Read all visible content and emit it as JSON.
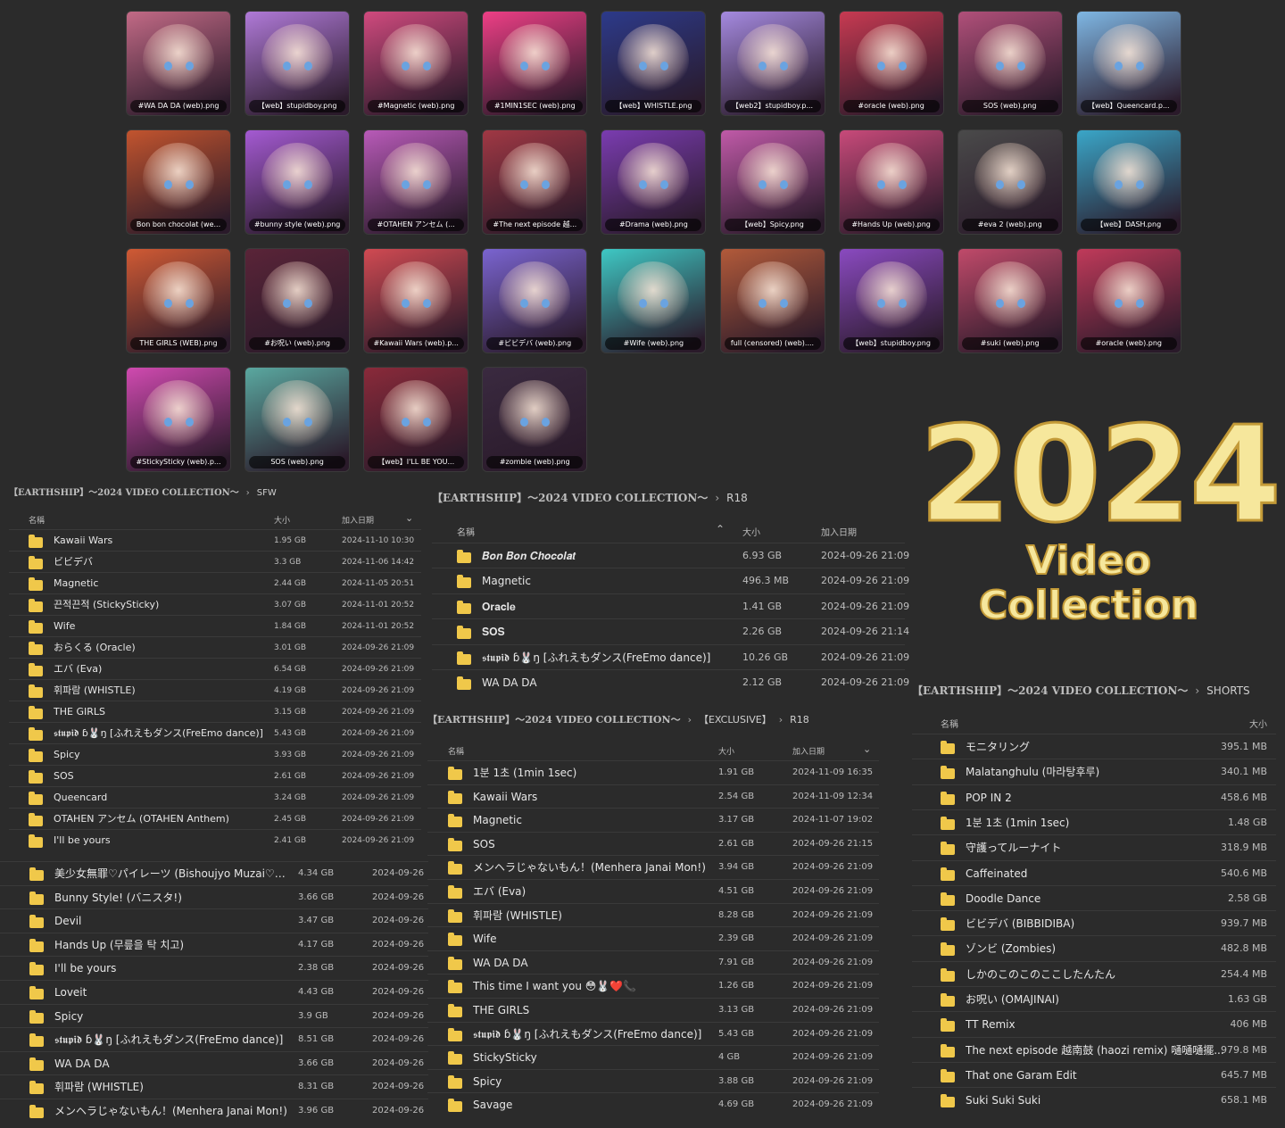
{
  "thumbnails": [
    {
      "label": "#WA DA DA (web).png",
      "color": "#c26a86"
    },
    {
      "label": "【web】stupidboy.png",
      "color": "#b07ad8"
    },
    {
      "label": "#Magnetic (web).png",
      "color": "#d04a7e"
    },
    {
      "label": "#1MIN1SEC (web).png",
      "color": "#ee3f86"
    },
    {
      "label": "【web】WHISTLE.png",
      "color": "#2c3a8a"
    },
    {
      "label": "【web2】stupidboy.p...",
      "color": "#a58ae0"
    },
    {
      "label": "#oracle (web).png",
      "color": "#c83a52"
    },
    {
      "label": "SOS (web).png",
      "color": "#b1507a"
    },
    {
      "label": "【web】Queencard.p...",
      "color": "#7fb7e4"
    },
    {
      "label": "Bon bon chocolat (we...",
      "color": "#c2542e"
    },
    {
      "label": "#bunny style (web).png",
      "color": "#a45ad2"
    },
    {
      "label": "#OTAHEN アンセム (...",
      "color": "#b85ab8"
    },
    {
      "label": "#The next episode 越...",
      "color": "#a03844"
    },
    {
      "label": "#Drama (web).png",
      "color": "#7a3cb0"
    },
    {
      "label": "【web】Spicy.png",
      "color": "#c05aa8"
    },
    {
      "label": "#Hands Up (web).png",
      "color": "#c84a7a"
    },
    {
      "label": "#eva 2 (web).png",
      "color": "#4a4a4a"
    },
    {
      "label": "【web】DASH.png",
      "color": "#3aa6c8"
    },
    {
      "label": "THE GIRLS (WEB).png",
      "color": "#d05a34"
    },
    {
      "label": "#お呪い (web).png",
      "color": "#5a2438"
    },
    {
      "label": "#Kawaii Wars (web).p...",
      "color": "#d04a52"
    },
    {
      "label": "#ビビデバ (web).png",
      "color": "#7a64d0"
    },
    {
      "label": "#Wife (web).png",
      "color": "#3ec8c4"
    },
    {
      "label": "full (censored) (web)....",
      "color": "#b25a3a"
    },
    {
      "label": "【web】stupidboy.png",
      "color": "#8a4ac0"
    },
    {
      "label": "#suki (web).png",
      "color": "#c04a6a"
    },
    {
      "label": "#oracle (web).png",
      "color": "#c03a5a"
    },
    {
      "label": "#StickySticky (web).p...",
      "color": "#d04ab0"
    },
    {
      "label": "SOS (web).png",
      "color": "#5aa8a0"
    },
    {
      "label": "【web】I'LL BE YOU...",
      "color": "#8a2a3a"
    },
    {
      "label": "#zombie (web).png",
      "color": "#3a2a40"
    }
  ],
  "banner": {
    "year": "2024",
    "subtitle": "Video Collection"
  },
  "sfw": {
    "crumb_root": "【EARTHSHIP】～2024 VIDEO COLLECTION～",
    "crumb_leaf": "SFW",
    "headers": {
      "name": "名稱",
      "size": "大小",
      "date": "加入日期"
    },
    "rows": [
      {
        "name": "Kawaii Wars",
        "size": "1.95 GB",
        "date": "2024-11-10 10:30"
      },
      {
        "name": "ビビデバ",
        "size": "3.3 GB",
        "date": "2024-11-06 14:42"
      },
      {
        "name": "Magnetic",
        "size": "2.44 GB",
        "date": "2024-11-05 20:51"
      },
      {
        "name": "끈적끈적 (StickySticky)",
        "size": "3.07 GB",
        "date": "2024-11-01 20:52"
      },
      {
        "name": "Wife",
        "size": "1.84 GB",
        "date": "2024-11-01 20:52"
      },
      {
        "name": "おらくる (Oracle)",
        "size": "3.01 GB",
        "date": "2024-09-26 21:09"
      },
      {
        "name": "エバ (Eva)",
        "size": "6.54 GB",
        "date": "2024-09-26 21:09"
      },
      {
        "name": "휘파람 (WHISTLE)",
        "size": "4.19 GB",
        "date": "2024-09-26 21:09"
      },
      {
        "name": "THE GIRLS",
        "size": "3.15 GB",
        "date": "2024-09-26 21:09"
      },
      {
        "name": "𝖘𝖙𝖚𝖕𝖎𝖉 ɓ🐰ŋ [ふれえもダンス(FreEmo dance)]",
        "size": "5.43 GB",
        "date": "2024-09-26 21:09"
      },
      {
        "name": "Spicy",
        "size": "3.93 GB",
        "date": "2024-09-26 21:09"
      },
      {
        "name": "SOS",
        "size": "2.61 GB",
        "date": "2024-09-26 21:09"
      },
      {
        "name": "Queencard",
        "size": "3.24 GB",
        "date": "2024-09-26 21:09"
      },
      {
        "name": "OTAHEN アンセム (OTAHEN Anthem)",
        "size": "2.45 GB",
        "date": "2024-09-26 21:09"
      },
      {
        "name": "I'll be yours",
        "size": "2.41 GB",
        "date": "2024-09-26 21:09"
      }
    ]
  },
  "extra": {
    "rows": [
      {
        "name": "美少女無罪♡パイレーツ (Bishoujyo Muzai♡Pirat...",
        "size": "4.34 GB",
        "date": "2024-09-26"
      },
      {
        "name": "Bunny Style! (バニスタ!)",
        "size": "3.66 GB",
        "date": "2024-09-26"
      },
      {
        "name": "Devil",
        "size": "3.47 GB",
        "date": "2024-09-26"
      },
      {
        "name": "Hands Up (무릎을 탁 치고)",
        "size": "4.17 GB",
        "date": "2024-09-26"
      },
      {
        "name": "I'll be yours",
        "size": "2.38 GB",
        "date": "2024-09-26"
      },
      {
        "name": "Loveit",
        "size": "4.43 GB",
        "date": "2024-09-26"
      },
      {
        "name": "Spicy",
        "size": "3.9 GB",
        "date": "2024-09-26"
      },
      {
        "name": "𝖘𝖙𝖚𝖕𝖎𝖉 ɓ🐰ŋ [ふれえもダンス(FreEmo dance)]",
        "size": "8.51 GB",
        "date": "2024-09-26"
      },
      {
        "name": "WA DA DA",
        "size": "3.66 GB",
        "date": "2024-09-26"
      },
      {
        "name": "휘파람 (WHISTLE)",
        "size": "8.31 GB",
        "date": "2024-09-26"
      },
      {
        "name": "メンヘラじゃないもん！(Menhera Janai Mon!)",
        "size": "3.96 GB",
        "date": "2024-09-26"
      }
    ]
  },
  "r18": {
    "crumb_root": "【EARTHSHIP】～2024 VIDEO COLLECTION～",
    "crumb_leaf": "R18",
    "headers": {
      "name": "名稱",
      "size": "大小",
      "date": "加入日期"
    },
    "rows": [
      {
        "name": "𝑩𝒐𝒏 𝑩𝒐𝒏 𝑪𝒉𝒐𝒄𝒐𝒍𝒂𝒕",
        "size": "6.93 GB",
        "date": "2024-09-26 21:09"
      },
      {
        "name": "Magnetic",
        "size": "496.3 MB",
        "date": "2024-09-26 21:09"
      },
      {
        "name": "𝐎𝐫𝐚𝐜𝐥𝐞",
        "size": "1.41 GB",
        "date": "2024-09-26 21:09"
      },
      {
        "name": "𝐒𝐎𝐒",
        "size": "2.26 GB",
        "date": "2024-09-26 21:14"
      },
      {
        "name": "𝖘𝖙𝖚𝖕𝖎𝖉 ɓ🐰ŋ [ふれえもダンス(FreEmo dance)]",
        "size": "10.26 GB",
        "date": "2024-09-26 21:09"
      },
      {
        "name": "WA DA DA",
        "size": "2.12 GB",
        "date": "2024-09-26 21:09"
      }
    ]
  },
  "exclusive": {
    "crumb_root": "【EARTHSHIP】～2024 VIDEO COLLECTION～",
    "crumb_mid": "【EXCLUSIVE】",
    "crumb_leaf": "R18",
    "headers": {
      "name": "名稱",
      "size": "大小",
      "date": "加入日期"
    },
    "rows": [
      {
        "name": "1분 1초 (1min 1sec)",
        "size": "1.91 GB",
        "date": "2024-11-09 16:35"
      },
      {
        "name": "Kawaii Wars",
        "size": "2.54 GB",
        "date": "2024-11-09 12:34"
      },
      {
        "name": "Magnetic",
        "size": "3.17 GB",
        "date": "2024-11-07 19:02"
      },
      {
        "name": "SOS",
        "size": "2.61 GB",
        "date": "2024-09-26 21:15"
      },
      {
        "name": "メンヘラじゃないもん！(Menhera Janai Mon!)",
        "size": "3.94 GB",
        "date": "2024-09-26 21:09"
      },
      {
        "name": "エバ (Eva)",
        "size": "4.51 GB",
        "date": "2024-09-26 21:09"
      },
      {
        "name": "휘파람 (WHISTLE)",
        "size": "8.28 GB",
        "date": "2024-09-26 21:09"
      },
      {
        "name": "Wife",
        "size": "2.39 GB",
        "date": "2024-09-26 21:09"
      },
      {
        "name": "WA DA DA",
        "size": "7.91 GB",
        "date": "2024-09-26 21:09"
      },
      {
        "name": "This time I want you 😳🐰❤️📞",
        "size": "1.26 GB",
        "date": "2024-09-26 21:09"
      },
      {
        "name": "THE GIRLS",
        "size": "3.13 GB",
        "date": "2024-09-26 21:09"
      },
      {
        "name": "𝖘𝖙𝖚𝖕𝖎𝖉 ɓ🐰ŋ [ふれえもダンス(FreEmo dance)]",
        "size": "5.43 GB",
        "date": "2024-09-26 21:09"
      },
      {
        "name": "StickySticky",
        "size": "4 GB",
        "date": "2024-09-26 21:09"
      },
      {
        "name": "Spicy",
        "size": "3.88 GB",
        "date": "2024-09-26 21:09"
      },
      {
        "name": "Savage",
        "size": "4.69 GB",
        "date": "2024-09-26 21:09"
      }
    ]
  },
  "shorts": {
    "crumb_root": "【EARTHSHIP】～2024 VIDEO COLLECTION～",
    "crumb_leaf": "SHORTS",
    "headers": {
      "name": "名稱",
      "size": "大小"
    },
    "rows": [
      {
        "name": "モニタリング",
        "size": "395.1 MB"
      },
      {
        "name": "Malatanghulu (마라탕후루)",
        "size": "340.1 MB"
      },
      {
        "name": "POP IN 2",
        "size": "458.6 MB"
      },
      {
        "name": "1분 1초 (1min 1sec)",
        "size": "1.48 GB"
      },
      {
        "name": "守護ってルーナイト",
        "size": "318.9 MB"
      },
      {
        "name": "Caffeinated",
        "size": "540.6 MB"
      },
      {
        "name": "Doodle Dance",
        "size": "2.58 GB"
      },
      {
        "name": "ビビデバ (BIBBIDIBA)",
        "size": "939.7 MB"
      },
      {
        "name": "ゾンビ (Zombies)",
        "size": "482.8 MB"
      },
      {
        "name": "しかのこのこのここしたんたん",
        "size": "254.4 MB"
      },
      {
        "name": "お呪い (OMAJINAI)",
        "size": "1.63 GB"
      },
      {
        "name": "TT Remix",
        "size": "406 MB"
      },
      {
        "name": "The next episode 越南鼓 (haozi remix) 嗵嗵嗵擺...",
        "size": "979.8 MB"
      },
      {
        "name": "That one Garam Edit",
        "size": "645.7 MB"
      },
      {
        "name": "Suki Suki Suki",
        "size": "658.1 MB"
      }
    ]
  }
}
